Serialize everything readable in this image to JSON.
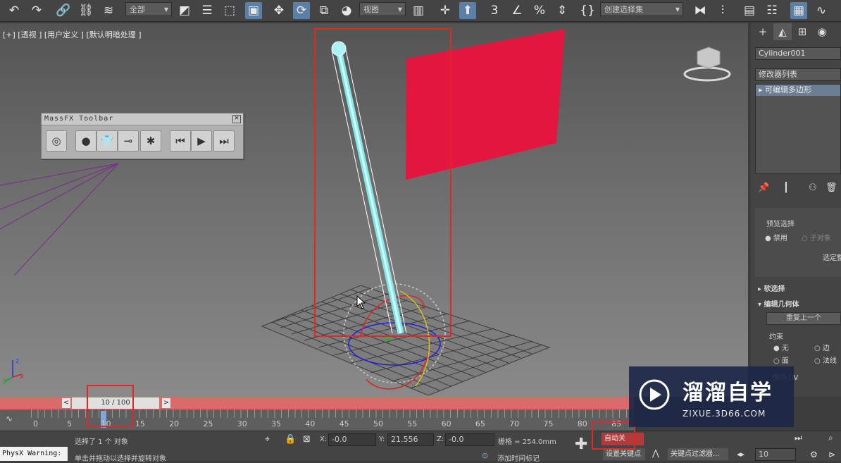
{
  "toolbar": {
    "filter_dropdown": "全部",
    "view_dropdown": "视图",
    "selection_set": "创建选择集"
  },
  "viewport": {
    "label": "[+] [透视 ] [用户定义 ] [默认明暗处理 ]",
    "axis_x": "x",
    "axis_y": "y",
    "axis_z": "z"
  },
  "massfx": {
    "title": "MassFX Toolbar",
    "close": "×"
  },
  "command_panel": {
    "object_name": "Cylinder001",
    "modifier_list": "修改器列表",
    "stack_item": "可编辑多边形",
    "preview_selection": "预览选择",
    "radio_disable": "禁用",
    "radio_subobj": "子对象",
    "select_by": "选定整",
    "soft_selection": "软选择",
    "edit_geometry": "编辑几何体",
    "repeat_last": "重复上一个",
    "constraints": "约束",
    "c_none": "无",
    "c_edge": "边",
    "c_face": "面",
    "c_normal": "法线",
    "keep_uv": "保持 UV"
  },
  "timeline": {
    "frame_counter": "10 / 100",
    "prev": "<",
    "next": ">",
    "ticks": [
      "0",
      "5",
      "10",
      "15",
      "20",
      "25",
      "30",
      "35",
      "40",
      "45",
      "50",
      "55",
      "60",
      "65",
      "70",
      "75",
      "80",
      "85"
    ]
  },
  "status": {
    "physx_warning": "PhysX Warning:",
    "selected": "选择了 1 个 对象",
    "hint": "单击并拖动以选择并旋转对象",
    "x_label": "X:",
    "x_value": "-0.0",
    "y_label": "Y:",
    "y_value": "21.556",
    "z_label": "Z:",
    "z_value": "-0.0",
    "grid": "栅格 = 254.0mm",
    "add_time_tag": "添加时间标记",
    "auto_key": "自动关",
    "set_key": "设置关键点",
    "key_filters": "关键点过滤器...",
    "frame_field": "10"
  },
  "watermark": {
    "brand": "溜溜自学",
    "url": "ZIXUE.3D66.COM"
  },
  "colors": {
    "highlight_box": "#e02828",
    "flag": "#e2163f",
    "cylinder": "#7fe8ec",
    "timebar": "#d96b6b"
  }
}
